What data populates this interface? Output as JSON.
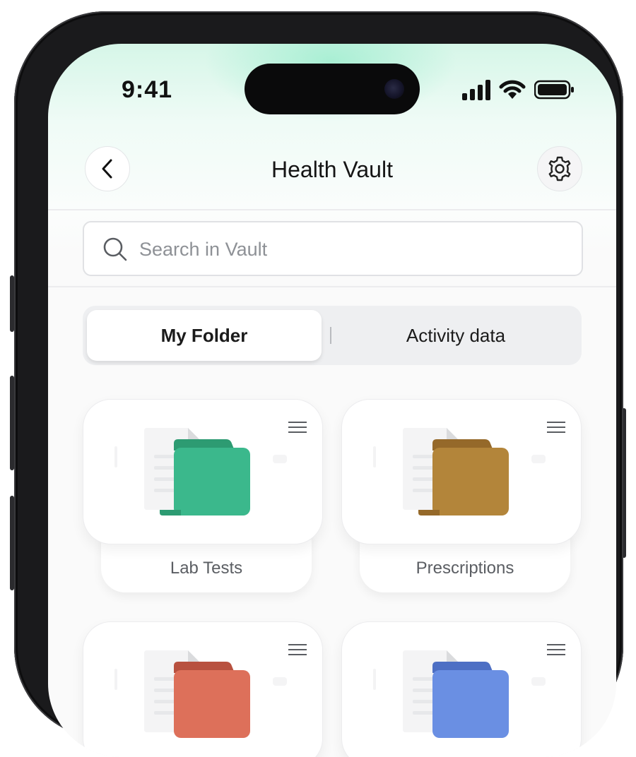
{
  "status_bar": {
    "time": "9:41"
  },
  "header": {
    "title": "Health Vault"
  },
  "search": {
    "placeholder": "Search in Vault",
    "value": ""
  },
  "tabs": [
    {
      "label": "My Folder",
      "selected": true
    },
    {
      "label": "Activity data",
      "selected": false
    }
  ],
  "folders": [
    {
      "label": "Lab Tests",
      "color": "#3bb88c",
      "tab_color": "#2d9b72"
    },
    {
      "label": "Prescriptions",
      "color": "#b3853a",
      "tab_color": "#95692a"
    },
    {
      "label": "",
      "color": "#dd705a",
      "tab_color": "#b8513f"
    },
    {
      "label": "",
      "color": "#6a8fe3",
      "tab_color": "#4d6fc4"
    }
  ],
  "colors": {
    "accent_glow": "#98eccc",
    "background": "#fafafa"
  }
}
